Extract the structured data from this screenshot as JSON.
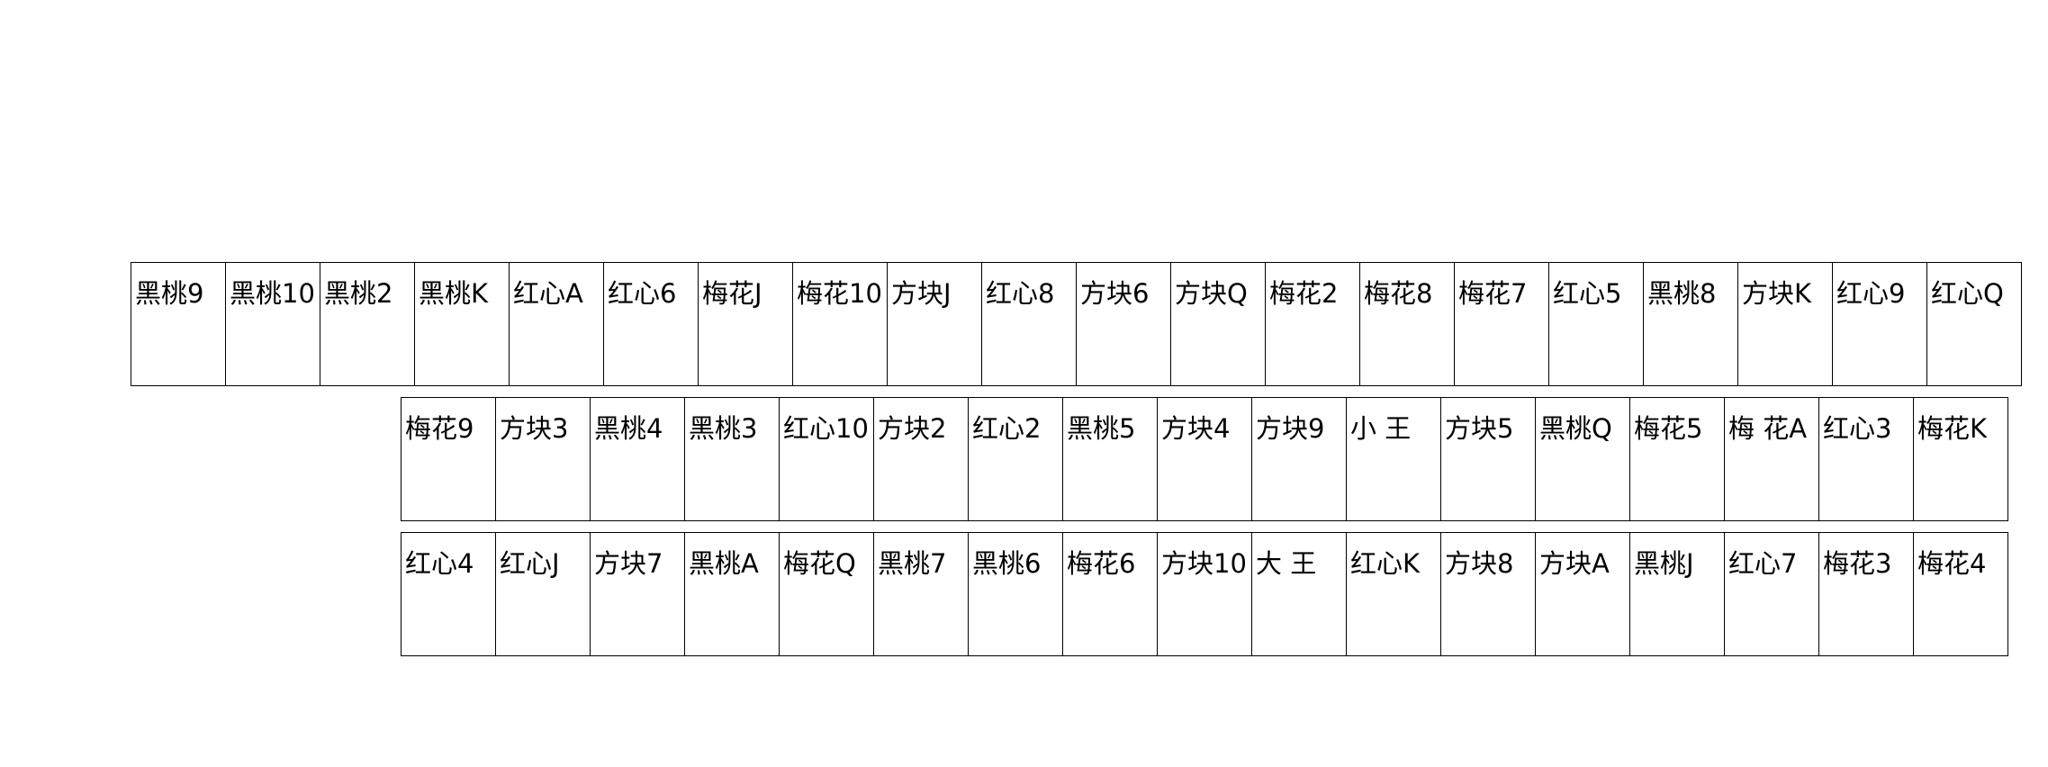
{
  "hands": [
    {
      "cards": [
        "黑桃9",
        "黑桃10",
        "黑桃2",
        "黑桃K",
        "红心A",
        "红心6",
        "梅花J",
        "梅花10",
        "方块J",
        "红心8",
        "方块6",
        "方块Q",
        "梅花2",
        "梅花8",
        "梅花7",
        "红心5",
        "黑桃8",
        "方块K",
        "红心9",
        "红心Q"
      ]
    },
    {
      "cards": [
        "梅花9",
        "方块3",
        "黑桃4",
        "黑桃3",
        "红心10",
        "方块2",
        "红心2",
        "黑桃5",
        "方块4",
        "方块9",
        "小 王",
        "方块5",
        "黑桃Q",
        "梅花5",
        "梅 花A",
        "红心3",
        "梅花K"
      ]
    },
    {
      "cards": [
        "红心4",
        "红心J",
        "方块7",
        "黑桃A",
        "梅花Q",
        "黑桃7",
        "黑桃6",
        "梅花6",
        "方块10",
        "大 王",
        "红心K",
        "方块8",
        "方块A",
        "黑桃J",
        "红心7",
        "梅花3",
        "梅花4"
      ]
    }
  ]
}
